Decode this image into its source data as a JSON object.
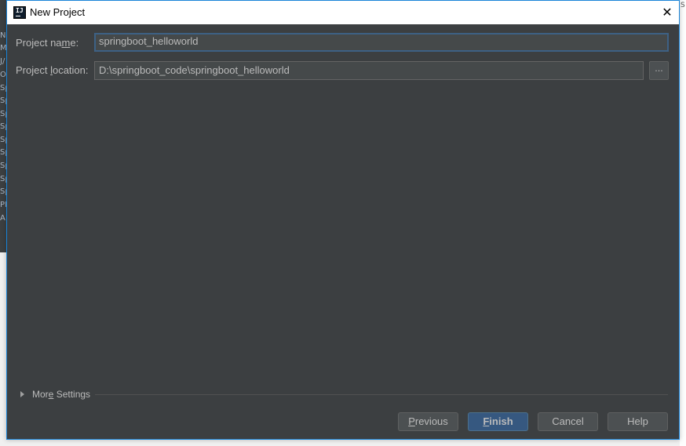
{
  "background_window": {
    "letters": [
      "N",
      "M",
      "J/",
      "O",
      "Sp",
      "Sp",
      "Sp",
      "Sp",
      "Sp",
      "Sp",
      "Sp",
      "Sp",
      "Sp",
      "Pl",
      "A"
    ],
    "right_edge_glyph": "S"
  },
  "dialog": {
    "title": "New Project",
    "close_glyph": "✕"
  },
  "form": {
    "project_name": {
      "label_pre": "Project na",
      "label_mnemonic": "m",
      "label_post": "e:",
      "value": "springboot_helloworld"
    },
    "project_location": {
      "label_pre": "Project ",
      "label_mnemonic": "l",
      "label_post": "ocation:",
      "value": "D:\\springboot_code\\springboot_helloworld",
      "browse_label": "..."
    }
  },
  "more_settings": {
    "label_pre": "Mor",
    "label_mnemonic": "e",
    "label_post": " Settings"
  },
  "buttons": {
    "previous": {
      "mnemonic": "P",
      "rest": "revious"
    },
    "finish": {
      "mnemonic": "F",
      "rest": "inish"
    },
    "cancel": "Cancel",
    "help": "Help"
  },
  "colors": {
    "dialog_bg": "#3c3f41",
    "field_bg": "#45494a",
    "text": "#bbbbbb",
    "focus_border": "#3d6185",
    "default_button": "#365880",
    "window_border": "#1883d7"
  }
}
